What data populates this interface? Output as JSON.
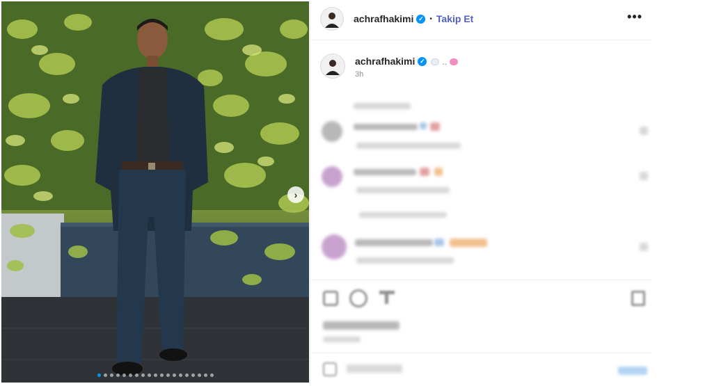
{
  "header": {
    "username": "achrafhakimi",
    "verified": true,
    "separator": "•",
    "follow_label": "Takip Et",
    "more_label": "•••"
  },
  "caption": {
    "username": "achrafhakimi",
    "text": "..",
    "time": "3h"
  },
  "carousel": {
    "next_label": "›",
    "dot_count": 19,
    "active_index": 0
  },
  "colors": {
    "verified_badge": "#0095f6",
    "follow_link": "#4e5fbf",
    "secondary_text": "#8e8e8e",
    "divider": "#efefef"
  },
  "icons": [
    "verified-icon",
    "more-options-icon",
    "heart-icon",
    "comment-icon",
    "share-icon",
    "bookmark-icon",
    "emoji-icon",
    "chevron-right-icon"
  ]
}
